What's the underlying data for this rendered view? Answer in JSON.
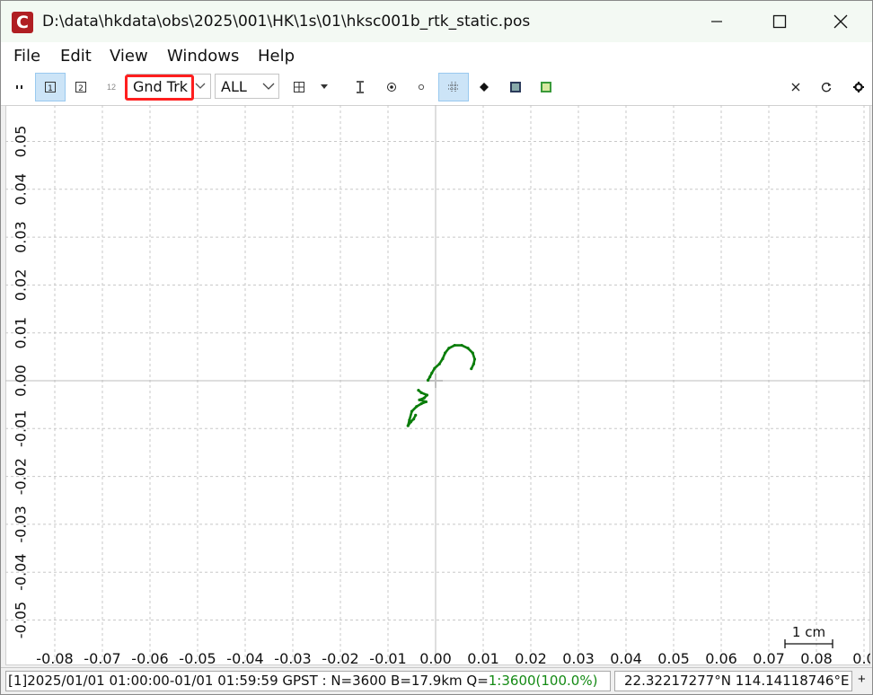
{
  "window": {
    "title": "D:\\data\\hkdata\\obs\\2025\\001\\HK\\1s\\01\\hksc001b_rtk_static.pos",
    "app_icon_letter": "C"
  },
  "menu": [
    "File",
    "Edit",
    "View",
    "Windows",
    "Help"
  ],
  "toolbar": {
    "btn_1": "1",
    "btn_2": "2",
    "btn_12": "12",
    "plot_type": "Gnd Trk",
    "quality": "ALL"
  },
  "chart_data": {
    "type": "scatter",
    "x_ticks": [
      "-0.08",
      "-0.07",
      "-0.06",
      "-0.05",
      "-0.04",
      "-0.03",
      "-0.02",
      "-0.01",
      "0.00",
      "0.01",
      "0.02",
      "0.03",
      "0.04",
      "0.05",
      "0.06",
      "0.07",
      "0.08",
      "0.0"
    ],
    "y_ticks": [
      "0.05",
      "0.04",
      "0.03",
      "0.02",
      "0.01",
      "0.00",
      "-0.01",
      "-0.02",
      "-0.03",
      "-0.04",
      "-0.05"
    ],
    "xlim": [
      -0.08,
      0.09
    ],
    "ylim": [
      -0.055,
      0.057
    ],
    "grid": true,
    "scale_label": "1 cm",
    "track_color": "#0a7d0a",
    "track": [
      [
        0.0075,
        0.0025
      ],
      [
        0.008,
        0.0035
      ],
      [
        0.0082,
        0.0045
      ],
      [
        0.0078,
        0.0058
      ],
      [
        0.0068,
        0.0068
      ],
      [
        0.0055,
        0.0074
      ],
      [
        0.004,
        0.0074
      ],
      [
        0.0028,
        0.0068
      ],
      [
        0.002,
        0.0058
      ],
      [
        0.0015,
        0.0046
      ],
      [
        0.0008,
        0.0035
      ],
      [
        -0.0002,
        0.0026
      ],
      [
        -0.0008,
        0.0016
      ],
      [
        -0.0012,
        0.0008
      ],
      [
        -0.0016,
        0.0001
      ]
    ],
    "track2": [
      [
        -0.0036,
        -0.002
      ],
      [
        -0.003,
        -0.0025
      ],
      [
        -0.0018,
        -0.003
      ],
      [
        -0.0024,
        -0.0036
      ],
      [
        -0.0034,
        -0.004
      ],
      [
        -0.002,
        -0.0044
      ],
      [
        -0.003,
        -0.0048
      ],
      [
        -0.004,
        -0.0054
      ],
      [
        -0.005,
        -0.0064
      ],
      [
        -0.0055,
        -0.0082
      ],
      [
        -0.0058,
        -0.0094
      ],
      [
        -0.0052,
        -0.0086
      ],
      [
        -0.0046,
        -0.008
      ],
      [
        -0.0042,
        -0.0072
      ]
    ]
  },
  "status": {
    "prefix": "[1]2025/01/01 01:00:00-01/01 01:59:59 GPST : N=3600 B=17.9km Q=",
    "quality": "1:3600(100.0%)",
    "coords": "22.32217277°N  114.14118746°E",
    "plus": "+"
  }
}
